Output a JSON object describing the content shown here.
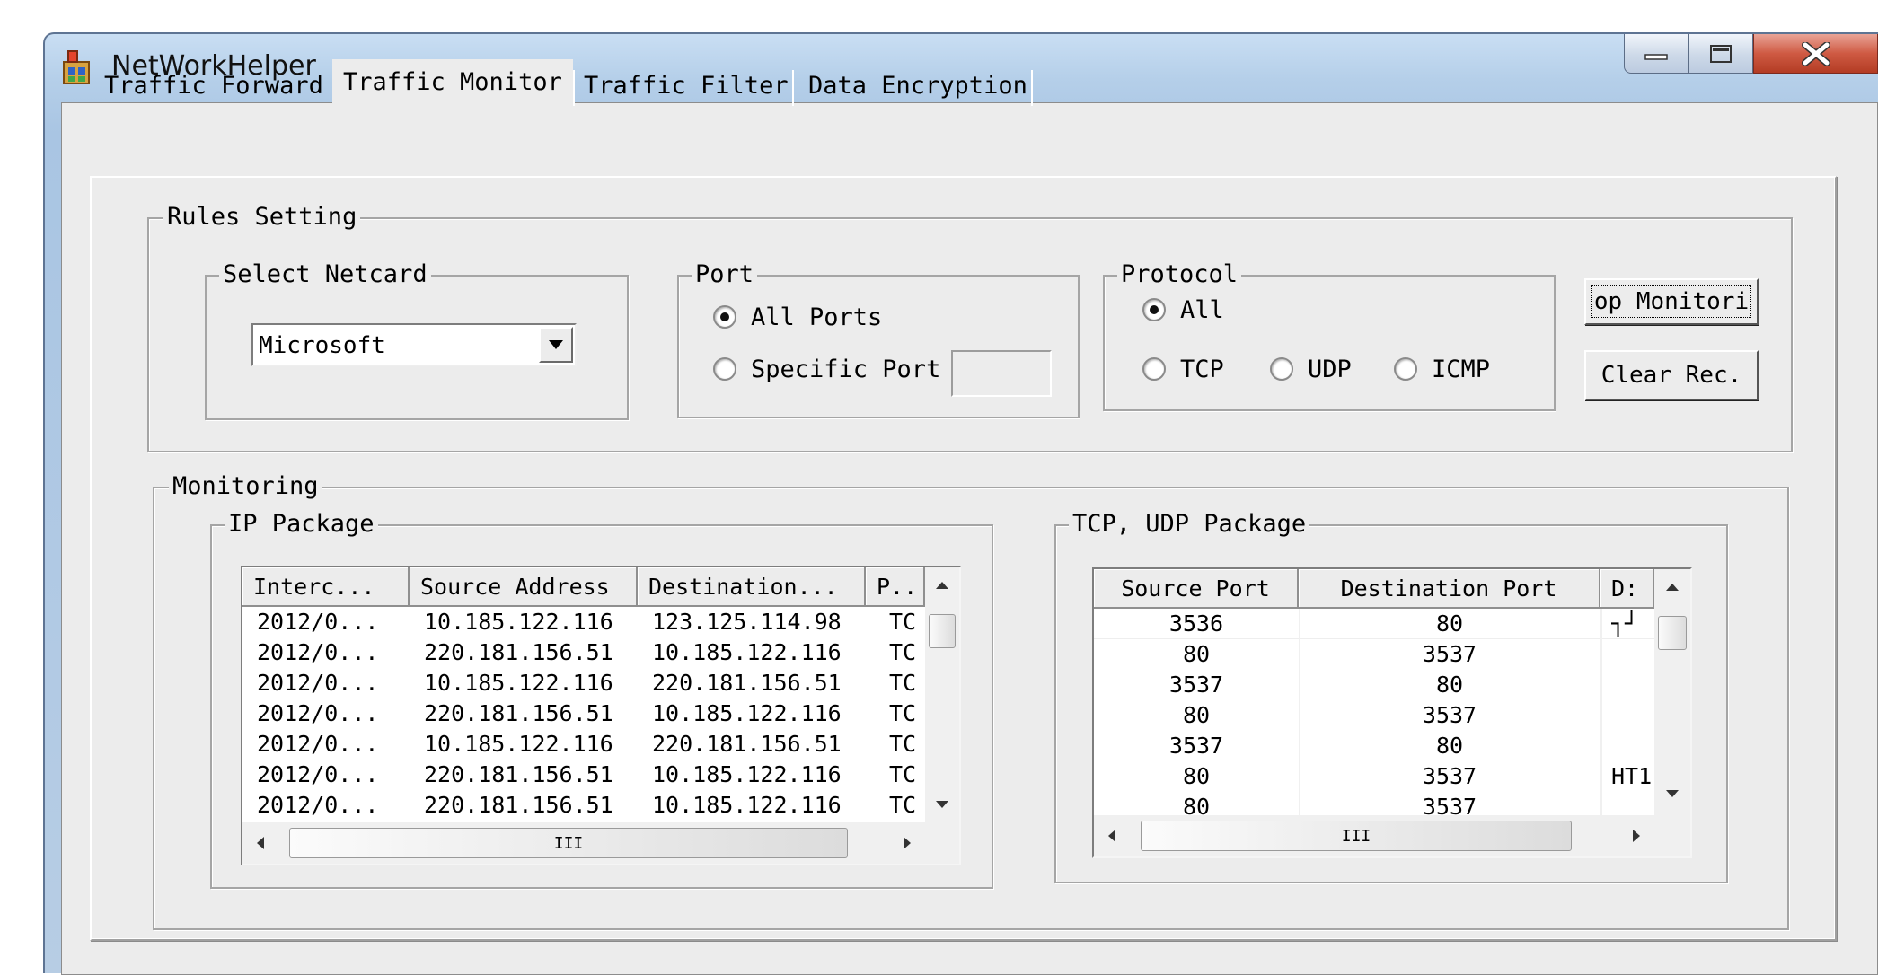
{
  "window": {
    "title": "NetWorkHelper",
    "icons": {
      "app": "network-app-icon",
      "minimize": "minimize-icon",
      "maximize": "maximize-icon",
      "close": "close-icon"
    }
  },
  "tabs": [
    {
      "label": "Traffic Forward",
      "selected": false
    },
    {
      "label": "Traffic Monitor",
      "selected": true
    },
    {
      "label": "Traffic Filter",
      "selected": false
    },
    {
      "label": "Data Encryption",
      "selected": false
    }
  ],
  "rules": {
    "title": "Rules Setting",
    "netcard": {
      "title": "Select Netcard",
      "value": "Microsoft"
    },
    "port": {
      "title": "Port",
      "all_label": "All Ports",
      "specific_label": "Specific Port",
      "specific_value": "",
      "selected": "All Ports"
    },
    "protocol": {
      "title": "Protocol",
      "all_label": "All",
      "tcp_label": "TCP",
      "udp_label": "UDP",
      "icmp_label": "ICMP",
      "selected": "All"
    },
    "stop_button": "op Monitori",
    "clear_button": "Clear Rec."
  },
  "monitoring": {
    "title": "Monitoring",
    "ip": {
      "title": "IP Package",
      "columns": [
        "Interc...",
        "Source Address",
        "Destination...",
        "P.."
      ],
      "rows": [
        [
          "2012/0...",
          "10.185.122.116",
          "123.125.114.98",
          "TC"
        ],
        [
          "2012/0...",
          "220.181.156.51",
          "10.185.122.116",
          "TC"
        ],
        [
          "2012/0...",
          "10.185.122.116",
          "220.181.156.51",
          "TC"
        ],
        [
          "2012/0...",
          "220.181.156.51",
          "10.185.122.116",
          "TC"
        ],
        [
          "2012/0...",
          "10.185.122.116",
          "220.181.156.51",
          "TC"
        ],
        [
          "2012/0...",
          "220.181.156.51",
          "10.185.122.116",
          "TC"
        ],
        [
          "2012/0...",
          "220.181.156.51",
          "10.185.122.116",
          "TC"
        ]
      ],
      "hscroll_grip": "III"
    },
    "tcp": {
      "title": "TCP, UDP Package",
      "columns": [
        "Source Port",
        "Destination Port",
        "D:"
      ],
      "rows": [
        [
          "3536",
          "80",
          "┐┘"
        ],
        [
          "80",
          "3537",
          ""
        ],
        [
          "3537",
          "80",
          ""
        ],
        [
          "80",
          "3537",
          ""
        ],
        [
          "3537",
          "80",
          ""
        ],
        [
          "80",
          "3537",
          "HT1"
        ],
        [
          "80",
          "3537",
          ""
        ]
      ],
      "hscroll_grip": "III"
    }
  },
  "colors": {
    "client_bg": "#ececec",
    "frame_blue": "#b5cfe9",
    "close_red": "#cf5a43"
  }
}
